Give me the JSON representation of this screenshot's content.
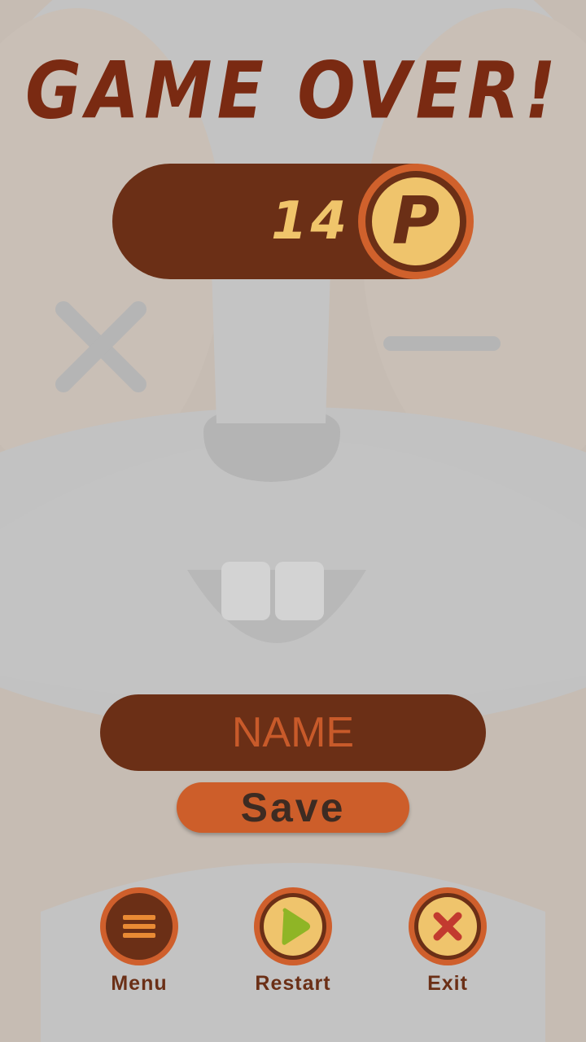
{
  "title": "GAME OVER!",
  "score": {
    "value": "14",
    "coin_letter": "P"
  },
  "name_input": {
    "placeholder": "NAME",
    "value": ""
  },
  "save_button": {
    "label": "Save"
  },
  "controls": [
    {
      "id": "menu",
      "label": "Menu",
      "icon": "menu-icon"
    },
    {
      "id": "restart",
      "label": "Restart",
      "icon": "play-icon"
    },
    {
      "id": "exit",
      "label": "Exit",
      "icon": "close-icon"
    }
  ],
  "colors": {
    "dark_brown": "#6b2f16",
    "orange": "#cf5f2c",
    "gold": "#efc46c",
    "title": "#7a2a12",
    "play_green": "#8fb526",
    "exit_red": "#c23a2f"
  }
}
